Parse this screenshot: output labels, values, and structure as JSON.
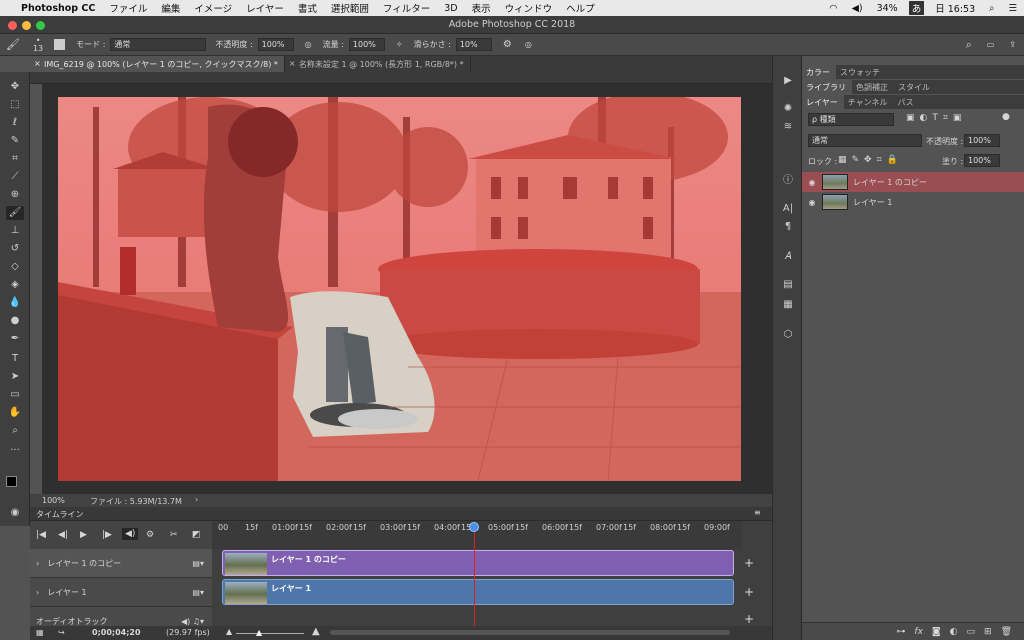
{
  "menubar": {
    "items": [
      "Photoshop CC",
      "ファイル",
      "編集",
      "イメージ",
      "レイヤー",
      "書式",
      "選択範囲",
      "フィルター",
      "3D",
      "表示",
      "ウィンドウ",
      "ヘルプ"
    ],
    "battery": "34%",
    "input_mode": "あ",
    "clock": "日 16:53"
  },
  "window": {
    "title": "Adobe Photoshop CC 2018"
  },
  "options": {
    "brush_size": "13",
    "mode_label": "モード :",
    "mode_value": "通常",
    "opacity_label": "不透明度 :",
    "opacity_value": "100%",
    "flow_label": "流量 :",
    "flow_value": "100%",
    "smoothing_label": "滑らかさ :",
    "smoothing_value": "10%"
  },
  "tabs": [
    {
      "label": "IMG_6219 @ 100% (レイヤー 1 のコピー, クイックマスク/8) *",
      "close": "×"
    },
    {
      "label": "名称未設定 1 @ 100% (長方形 1, RGB/8*) *",
      "close": "×"
    }
  ],
  "status": {
    "zoom": "100%",
    "file": "ファイル : 5.93M/13.7M",
    "arrow": "›"
  },
  "panel": {
    "top_tabs": [
      "カラー",
      "スウォッチ"
    ],
    "mid_tabs": [
      "ライブラリ",
      "色調補正",
      "スタイル"
    ],
    "layer_tabs": [
      "レイヤー",
      "チャンネル",
      "パス"
    ],
    "filter_label": "ρ 種類",
    "blend_mode": "通常",
    "opacity_label": "不透明度 :",
    "opacity_value": "100%",
    "lock_label": "ロック :",
    "fill_label": "塗り :",
    "fill_value": "100%",
    "layers": [
      {
        "name": "レイヤー 1 のコピー",
        "selected": true
      },
      {
        "name": "レイヤー 1",
        "selected": false
      }
    ],
    "footer_icons": [
      "link-icon",
      "fx-icon",
      "mask-icon",
      "adjustment-icon",
      "group-icon",
      "new-layer-icon",
      "trash-icon"
    ]
  },
  "timeline": {
    "title": "タイムライン",
    "ticks": [
      "00",
      "15f",
      "01:00f",
      "15f",
      "02:00f",
      "15f",
      "03:00f",
      "15f",
      "04:00f",
      "15f",
      "05:00f",
      "15f",
      "06:00f",
      "15f",
      "07:00f",
      "15f",
      "08:00f",
      "15f",
      "09:00f"
    ],
    "tracks": [
      {
        "label": "レイヤー 1 のコピー",
        "clip": "レイヤー 1 のコピー",
        "color": "#7f5fb0"
      },
      {
        "label": "レイヤー 1",
        "clip": "レイヤー 1",
        "color": "#4f76a8"
      }
    ],
    "audio_label": "オーディオトラック",
    "timecode": "0;00;04;20",
    "fps": "(29.97 fps)"
  },
  "colors": {
    "mask_overlay": "#e05050",
    "accent": "#4a90e2",
    "playhead": "#e02020"
  }
}
